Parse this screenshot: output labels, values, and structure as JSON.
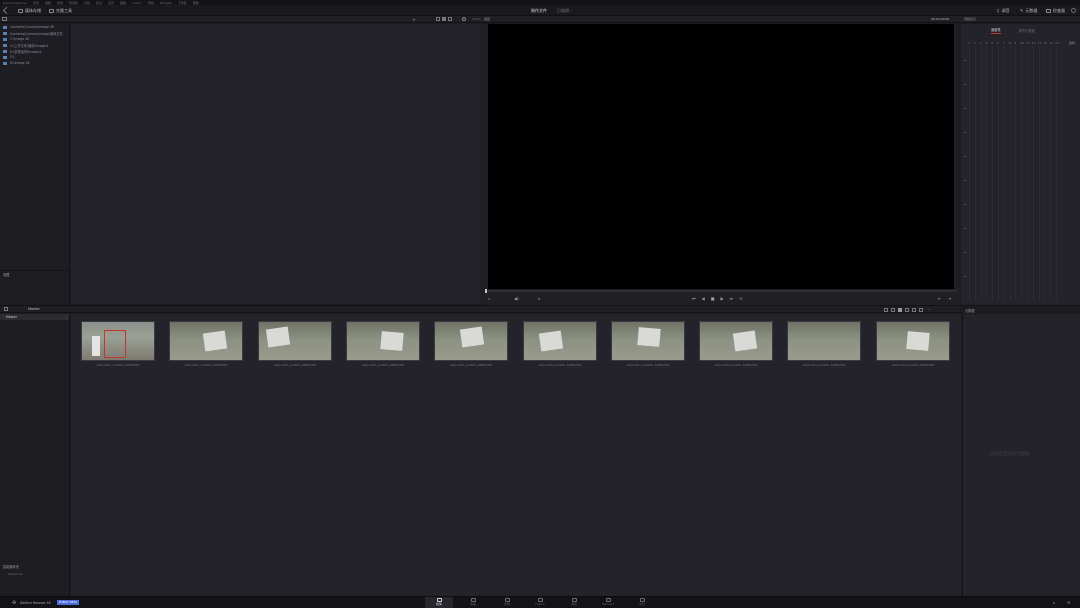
{
  "menu": [
    "DaVinci Resolve",
    "文件",
    "编辑",
    "修剪",
    "时间线",
    "片段",
    "标记",
    "显示",
    "播放",
    "Fusion",
    "调色",
    "Fairlight",
    "工作区",
    "帮助"
  ],
  "toolbar": {
    "media_pool": "媒体存储",
    "clone_tool": "克隆工具",
    "project_name": "制作文件",
    "status": "已编辑",
    "audio": "调音",
    "effects": "元数据",
    "inspector": "检查器",
    "zoom_value": "100%",
    "fit_label": "适配",
    "timecode": "00:00:00:00",
    "audio_meter_label": "音频表示"
  },
  "left_tree": {
    "items": [
      "Contents\\Camera\\Image 4K",
      "Contents\\Camera\\Image\\媒体文件",
      "C:\\Image 4K",
      "C:\\工作文件\\媒体\\Image\\1",
      "D:\\影视素材\\Image\\2",
      "D:\\",
      "D:\\Image 4K"
    ],
    "favorites_label": "收藏"
  },
  "meter": {
    "tabs": [
      "速度表",
      "调节式表面"
    ],
    "channels": [
      "1",
      "2",
      "3",
      "4",
      "5",
      "6",
      "7",
      "8",
      "9",
      "10",
      "11",
      "12",
      "13",
      "14",
      "15",
      "16"
    ],
    "extra": "监听"
  },
  "viewer": {
    "left_label": "A",
    "right_label": "B",
    "controls": [
      "⏮",
      "◀",
      "■",
      "▶",
      "⏭",
      "⟲"
    ]
  },
  "media_pool": {
    "title": "Master",
    "sidebar_master": "Master",
    "smart_bins_label": "智能媒体夹",
    "smart_bins_item": "Keywords",
    "metadata_label": "元数据",
    "empty_text": "没有可显示的元数据",
    "clips": [
      {
        "name": "A001C001_210605_R4BM.MP4"
      },
      {
        "name": "A001C002_210605_R4BM.MP4"
      },
      {
        "name": "A001C003_210605_R4BM.MP4"
      },
      {
        "name": "A001C004_210605_R4BM.MP4"
      },
      {
        "name": "A001C005_210605_R4BM.MP4"
      },
      {
        "name": "A001C006_210605_R4BM.MP4"
      },
      {
        "name": "A001C007_210605_R4BM.MP4"
      },
      {
        "name": "A001C008_210605_R4BM.MP4"
      },
      {
        "name": "A001C009_210605_R4BM.MP4"
      },
      {
        "name": "A001C010_210605_R4BM.MP4"
      }
    ]
  },
  "pages": [
    {
      "label": "媒体"
    },
    {
      "label": "快编"
    },
    {
      "label": "剪辑"
    },
    {
      "label": "Fusion"
    },
    {
      "label": "调色"
    },
    {
      "label": "Fairlight"
    },
    {
      "label": "交付"
    }
  ],
  "app": {
    "name": "DaVinci Resolve 16",
    "badge": "PUBLIC BETA"
  },
  "colors": {
    "accent": "#4a6bd8",
    "bg": "#1c1c20",
    "panel": "#232329"
  }
}
